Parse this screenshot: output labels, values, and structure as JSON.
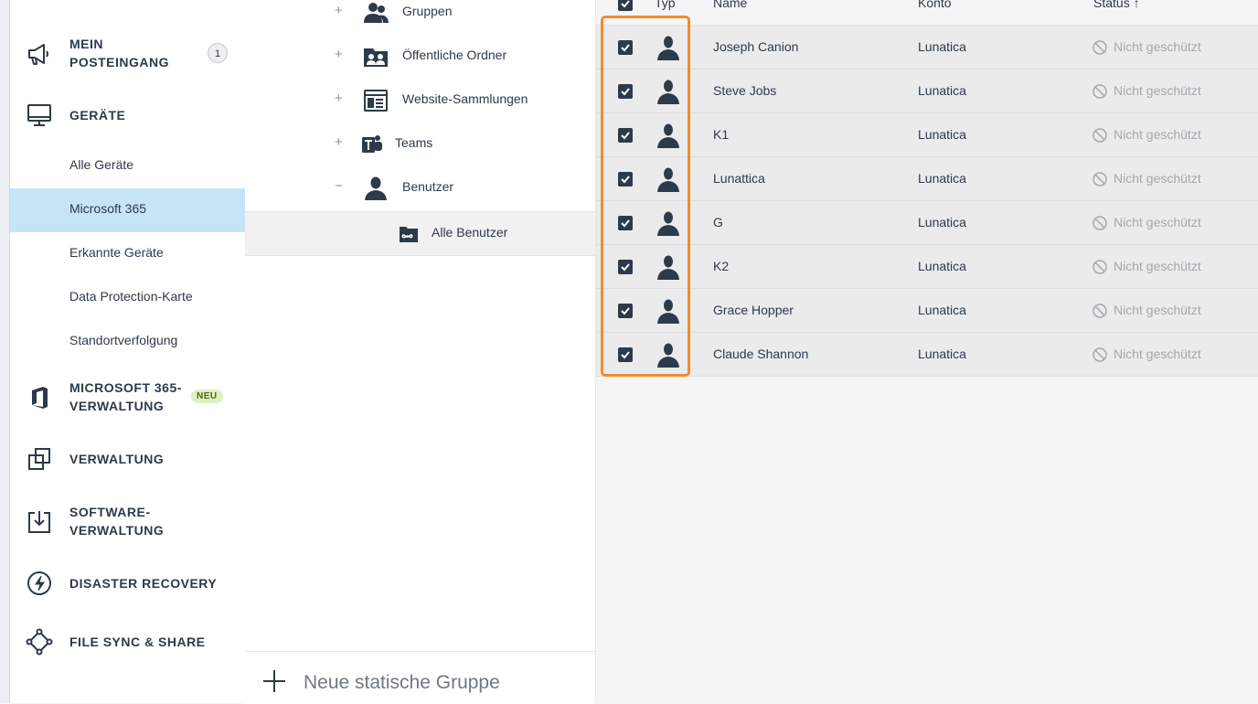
{
  "sidebar": {
    "posteingang_label": "MEIN\nPOSTEINGANG",
    "posteingang_count": "1",
    "geraete_label": "GERÄTE",
    "geraete_items": [
      {
        "label": "Alle Geräte"
      },
      {
        "label": "Microsoft 365"
      },
      {
        "label": "Erkannte Geräte"
      },
      {
        "label": "Data Protection-Karte"
      },
      {
        "label": "Standortverfolgung"
      }
    ],
    "m365_label": "MICROSOFT 365-\nVERWALTUNG",
    "m365_badge": "NEU",
    "verwaltung_label": "VERWALTUNG",
    "software_label": "SOFTWARE-\nVERWALTUNG",
    "disaster_label": "DISASTER RECOVERY",
    "filesync_label": "FILE SYNC & SHARE"
  },
  "tree": {
    "items": [
      {
        "label": "Gruppen",
        "toggle": "+",
        "icon": "group-icon"
      },
      {
        "label": "Öffentliche Ordner",
        "toggle": "+",
        "icon": "public-folder-icon"
      },
      {
        "label": "Website-Sammlungen",
        "toggle": "+",
        "icon": "website-icon"
      },
      {
        "label": "Teams",
        "toggle": "+",
        "icon": "teams-icon"
      },
      {
        "label": "Benutzer",
        "toggle": "−",
        "icon": "user-icon"
      },
      {
        "label": "Alle Benutzer",
        "toggle": "",
        "icon": "infinity-folder-icon"
      }
    ],
    "footer_label": "Neue statische Gruppe"
  },
  "table": {
    "headers": {
      "typ": "Typ",
      "name": "Name",
      "konto": "Konto",
      "status": "Status ↑"
    },
    "rows": [
      {
        "name": "Joseph Canion",
        "konto": "Lunatica",
        "status": "Nicht geschützt"
      },
      {
        "name": "Steve Jobs",
        "konto": "Lunatica",
        "status": "Nicht geschützt"
      },
      {
        "name": "K1",
        "konto": "Lunatica",
        "status": "Nicht geschützt"
      },
      {
        "name": "Lunattica",
        "konto": "Lunatica",
        "status": "Nicht geschützt"
      },
      {
        "name": "G",
        "konto": "Lunatica",
        "status": "Nicht geschützt"
      },
      {
        "name": "K2",
        "konto": "Lunatica",
        "status": "Nicht geschützt"
      },
      {
        "name": "Grace Hopper",
        "konto": "Lunatica",
        "status": "Nicht geschützt"
      },
      {
        "name": "Claude Shannon",
        "konto": "Lunatica",
        "status": "Nicht geschützt"
      }
    ]
  },
  "colors": {
    "active_item": "#c5e4f6",
    "highlight_border": "#f28c2e",
    "text_dark": "#2d3a4a",
    "status_gray": "#a3a9ae"
  }
}
